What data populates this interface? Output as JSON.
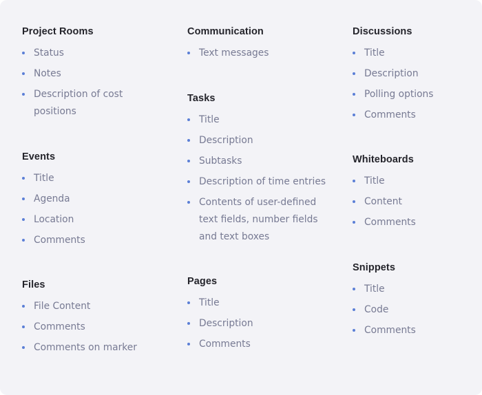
{
  "colors": {
    "background": "#f3f3f7",
    "heading": "#24242b",
    "item": "#777a93",
    "bullet": "#5b7fd6"
  },
  "sections": {
    "project_rooms": {
      "title": "Project Rooms",
      "items": [
        "Status",
        "Notes",
        "Description of cost positions"
      ]
    },
    "events": {
      "title": "Events",
      "items": [
        "Title",
        "Agenda",
        "Location",
        "Comments"
      ]
    },
    "files": {
      "title": "Files",
      "items": [
        "File Content",
        "Comments",
        "Comments on marker"
      ]
    },
    "communication": {
      "title": "Communication",
      "items": [
        "Text messages"
      ]
    },
    "tasks": {
      "title": "Tasks",
      "items": [
        "Title",
        "Description",
        "Subtasks",
        "Description of time entries",
        "Contents of user-defined text fields, number fields and text boxes"
      ]
    },
    "pages": {
      "title": "Pages",
      "items": [
        "Title",
        "Description",
        "Comments"
      ]
    },
    "discussions": {
      "title": "Discussions",
      "items": [
        "Title",
        "Description",
        "Polling options",
        "Comments"
      ]
    },
    "whiteboards": {
      "title": "Whiteboards",
      "items": [
        "Title",
        "Content",
        "Comments"
      ]
    },
    "snippets": {
      "title": "Snippets",
      "items": [
        "Title",
        "Code",
        "Comments"
      ]
    }
  }
}
